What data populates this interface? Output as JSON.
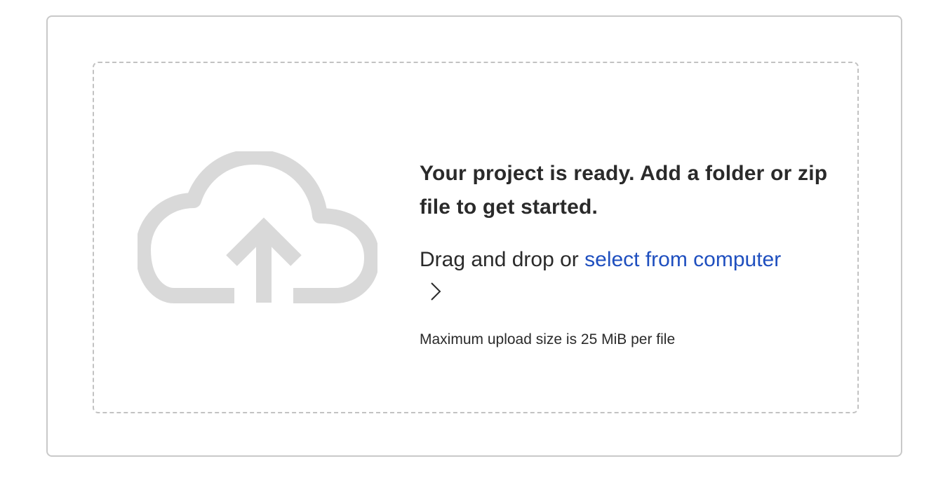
{
  "upload": {
    "heading": "Your project is ready. Add a folder or zip file to get started.",
    "drag_prefix": "Drag and drop or ",
    "select_link": "select from computer",
    "max_size_note": "Maximum upload size is 25 MiB per file"
  },
  "icons": {
    "cloud": "cloud-upload-icon",
    "chevron": "chevron-right-icon"
  },
  "colors": {
    "link": "#1f4fbf",
    "icon_gray": "#d9d9d9",
    "text": "#2a2a2a",
    "border": "#c9c9c9"
  }
}
